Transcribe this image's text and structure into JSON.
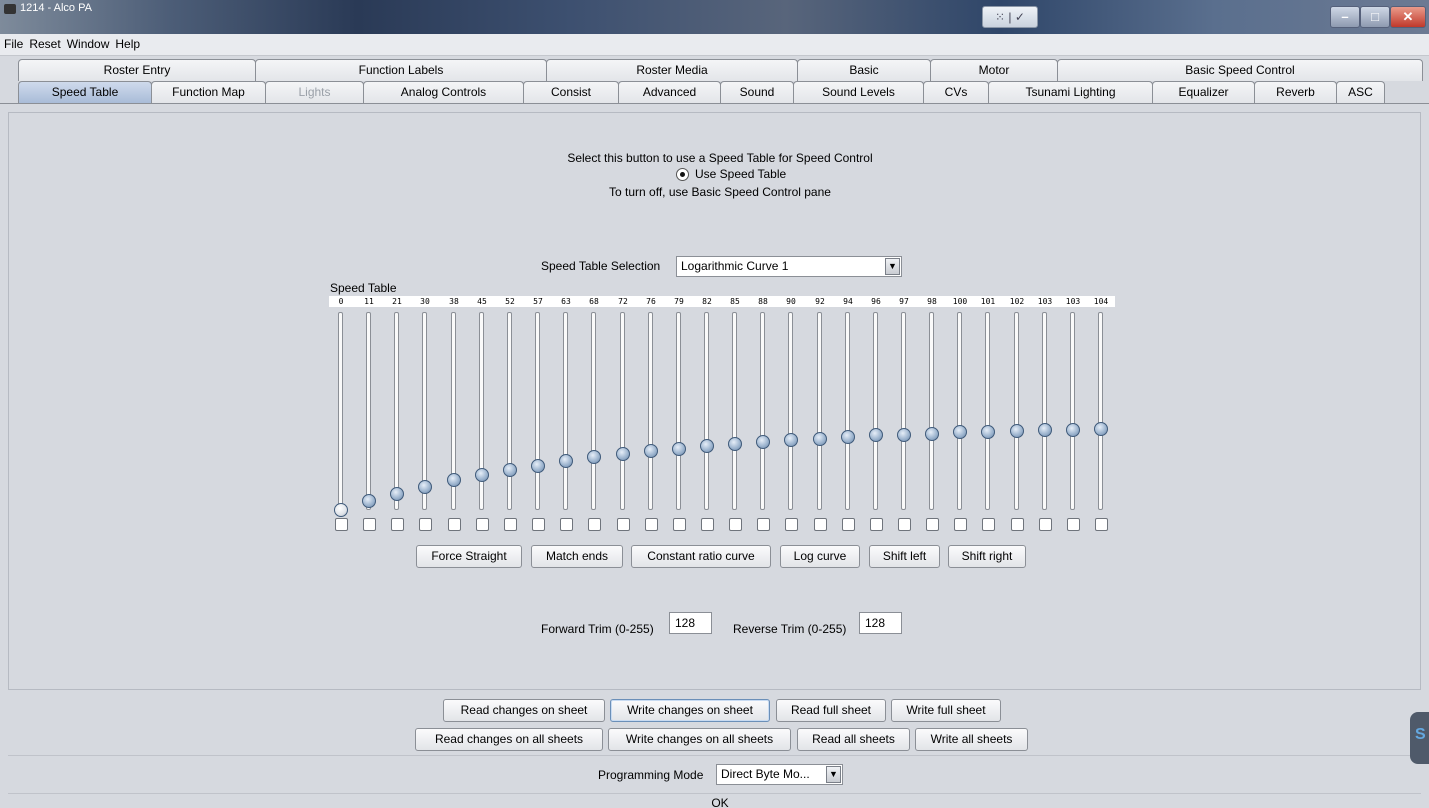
{
  "window": {
    "title": "1214 - Alco PA"
  },
  "menu": [
    "File",
    "Reset",
    "Window",
    "Help"
  ],
  "tabs_row1": [
    "Roster Entry",
    "Function Labels",
    "Roster Media",
    "Basic",
    "Motor",
    "Basic Speed Control"
  ],
  "tabs_row2": [
    "Speed Table",
    "Function Map",
    "Lights",
    "Analog Controls",
    "Consist",
    "Advanced",
    "Sound",
    "Sound Levels",
    "CVs",
    "Tsunami Lighting",
    "Equalizer",
    "Reverb",
    "ASC"
  ],
  "selected_tab": "Speed Table",
  "disabled_tab": "Lights",
  "speed_control": {
    "line1": "Select this button to use a Speed Table for Speed Control",
    "radio_label": "Use Speed Table",
    "radio_selected": true,
    "line3": "To turn off, use Basic Speed Control pane"
  },
  "selection": {
    "label": "Speed Table Selection",
    "value": "Logarithmic Curve 1"
  },
  "speed_table": {
    "label": "Speed Table",
    "max": 255,
    "values": [
      0,
      11,
      21,
      30,
      38,
      45,
      52,
      57,
      63,
      68,
      72,
      76,
      79,
      82,
      85,
      88,
      90,
      92,
      94,
      96,
      97,
      98,
      100,
      101,
      102,
      103,
      103,
      104
    ]
  },
  "curve_buttons": [
    "Force Straight",
    "Match ends",
    "Constant ratio curve",
    "Log curve",
    "Shift left",
    "Shift right"
  ],
  "trim": {
    "forward_label": "Forward Trim (0-255)",
    "forward_value": "128",
    "reverse_label": "Reverse Trim (0-255)",
    "reverse_value": "128"
  },
  "sheet_buttons_row1": [
    "Read changes on sheet",
    "Write changes on sheet",
    "Read full sheet",
    "Write full sheet"
  ],
  "sheet_buttons_row2": [
    "Read changes on all sheets",
    "Write changes on all sheets",
    "Read all sheets",
    "Write all sheets"
  ],
  "programming": {
    "label": "Programming Mode",
    "value": "Direct Byte Mo..."
  },
  "status": "OK"
}
